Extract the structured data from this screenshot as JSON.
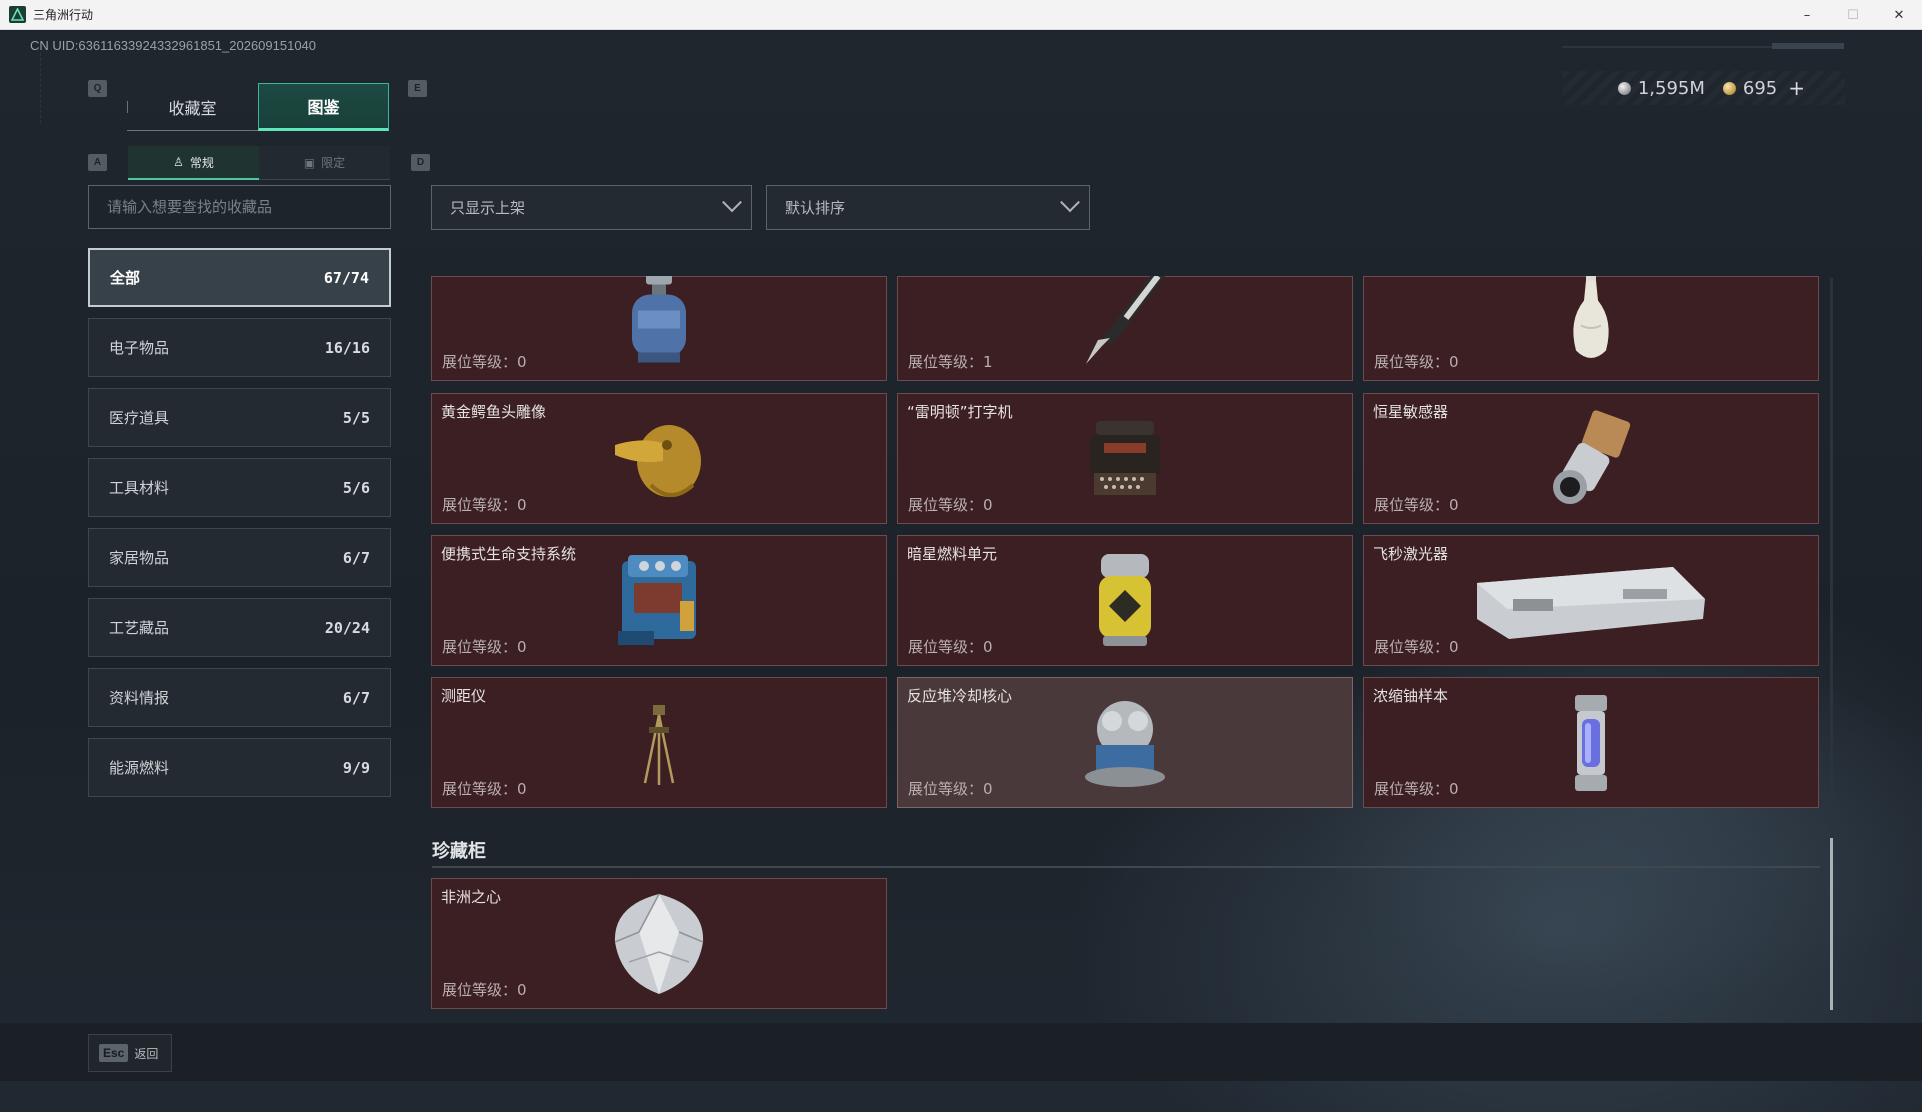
{
  "window": {
    "title": "三角洲行动",
    "controls": {
      "minimize": "–",
      "maximize": "☐",
      "close": "✕"
    }
  },
  "uid": "CN UID:63611633924332961851_202609151040",
  "currency": {
    "silver": {
      "icon": "silver-coin-icon",
      "value": "1,595M"
    },
    "gold": {
      "icon": "gold-coin-icon",
      "value": "695"
    },
    "add": "+"
  },
  "keys": {
    "q": "Q",
    "e": "E",
    "a": "A",
    "d": "D"
  },
  "main_tabs": [
    {
      "label": "收藏室",
      "active": false
    },
    {
      "label": "图鉴",
      "active": true
    }
  ],
  "sub_tabs": [
    {
      "label": "常规",
      "icon": "figure-icon",
      "active": true
    },
    {
      "label": "限定",
      "icon": "picture-icon",
      "active": false
    }
  ],
  "search": {
    "placeholder": "请输入想要查找的收藏品"
  },
  "categories": [
    {
      "label": "全部",
      "count": "67/74",
      "active": true
    },
    {
      "label": "电子物品",
      "count": "16/16"
    },
    {
      "label": "医疗道具",
      "count": "5/5"
    },
    {
      "label": "工具材料",
      "count": "5/6"
    },
    {
      "label": "家居物品",
      "count": "6/7"
    },
    {
      "label": "工艺藏品",
      "count": "20/24"
    },
    {
      "label": "资料情报",
      "count": "6/7"
    },
    {
      "label": "能源燃料",
      "count": "9/9"
    }
  ],
  "filters": {
    "shelf_filter": "只显示上架",
    "sort": "默认排序"
  },
  "level_label": "展位等级：",
  "cards": [
    {
      "name": "",
      "level": "0",
      "icon": "gas-canister-icon"
    },
    {
      "name": "",
      "level": "1",
      "icon": "fountain-pen-icon"
    },
    {
      "name": "",
      "level": "0",
      "icon": "porcelain-vase-icon"
    },
    {
      "name": "黄金鳄鱼头雕像",
      "level": "0",
      "icon": "golden-crocodile-head-icon"
    },
    {
      "name": "“雷明顿”打字机",
      "level": "0",
      "icon": "typewriter-icon"
    },
    {
      "name": "恒星敏感器",
      "level": "0",
      "icon": "star-sensor-icon"
    },
    {
      "name": "便携式生命支持系统",
      "level": "0",
      "icon": "life-support-system-icon"
    },
    {
      "name": "暗星燃料单元",
      "level": "0",
      "icon": "fuel-cell-icon"
    },
    {
      "name": "飞秒激光器",
      "level": "0",
      "icon": "femtosecond-laser-icon"
    },
    {
      "name": "测距仪",
      "level": "0",
      "icon": "rangefinder-tripod-icon"
    },
    {
      "name": "反应堆冷却核心",
      "level": "0",
      "icon": "reactor-cooling-core-icon",
      "hover": true
    },
    {
      "name": "浓缩铀样本",
      "level": "0",
      "icon": "uranium-sample-icon"
    }
  ],
  "section": {
    "title": "珍藏柜",
    "cards": [
      {
        "name": "非洲之心",
        "level": "0",
        "icon": "diamond-icon"
      }
    ]
  },
  "footer": {
    "esc_key": "Esc",
    "back_label": "返回"
  },
  "colors": {
    "accent_green": "#5ee6b9",
    "card_bg": "#3c1f22",
    "card_border": "#6e4a4c",
    "background": "#1d232b"
  }
}
